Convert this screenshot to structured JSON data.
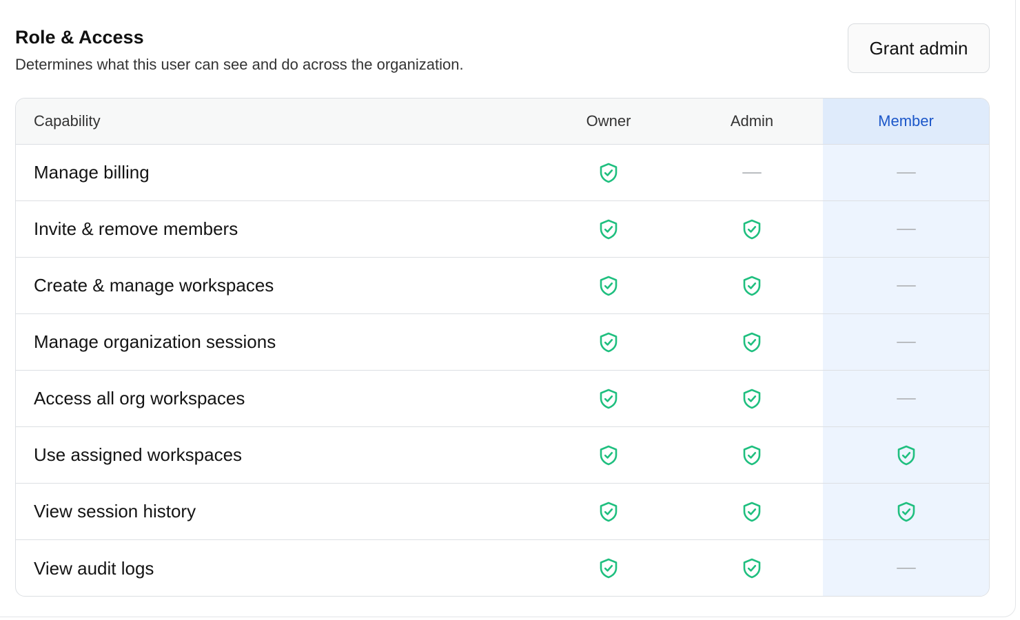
{
  "section": {
    "title": "Role & Access",
    "subtitle": "Determines what this user can see and do across the organization.",
    "grant_button": "Grant admin"
  },
  "table": {
    "headers": {
      "capability": "Capability",
      "owner": "Owner",
      "admin": "Admin",
      "member": "Member"
    },
    "highlighted_column": "member",
    "rows": [
      {
        "capability": "Manage billing",
        "owner": true,
        "admin": false,
        "member": false
      },
      {
        "capability": "Invite & remove members",
        "owner": true,
        "admin": true,
        "member": false
      },
      {
        "capability": "Create & manage workspaces",
        "owner": true,
        "admin": true,
        "member": false
      },
      {
        "capability": "Manage organization sessions",
        "owner": true,
        "admin": true,
        "member": false
      },
      {
        "capability": "Access all org workspaces",
        "owner": true,
        "admin": true,
        "member": false
      },
      {
        "capability": "Use assigned workspaces",
        "owner": true,
        "admin": true,
        "member": true
      },
      {
        "capability": "View session history",
        "owner": true,
        "admin": true,
        "member": true
      },
      {
        "capability": "View audit logs",
        "owner": true,
        "admin": true,
        "member": false
      }
    ]
  },
  "icons": {
    "allowed": "shield-check-icon",
    "denied": "dash-icon"
  },
  "colors": {
    "allowed_icon": "#1fbf7f",
    "member_header_text": "#1c57c9",
    "member_header_bg": "#dfebfb",
    "member_column_bg": "#edf4fe"
  }
}
